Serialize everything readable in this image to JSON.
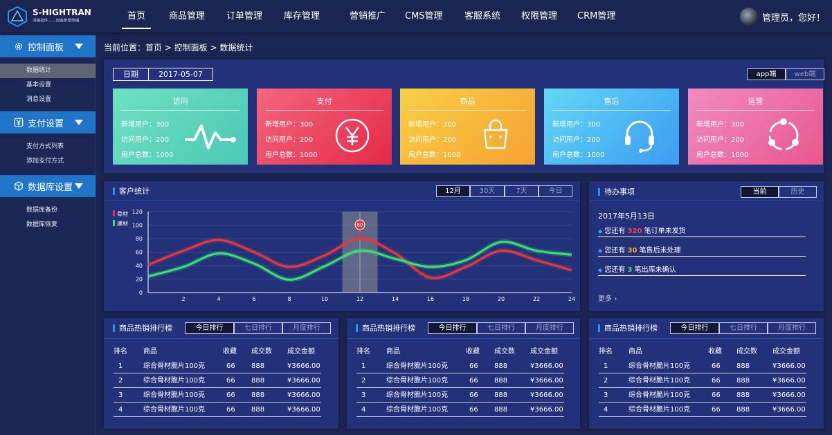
{
  "brand": {
    "name": "S-HIGHTRAN",
    "slogan": "洪锋软件——创造梦想传播"
  },
  "nav": [
    "首页",
    "商品管理",
    "订单管理",
    "库存管理",
    "营销推广",
    "CMS管理",
    "客服系统",
    "权限管理",
    "CRM管理"
  ],
  "user": {
    "greeting": "管理员，您好！"
  },
  "sidebar": {
    "groups": [
      {
        "title": "控制面板",
        "items": [
          "数据统计",
          "基本设置",
          "消息设置"
        ]
      },
      {
        "title": "支付设置",
        "items": [
          "支付方式列表",
          "添加支付方式"
        ]
      },
      {
        "title": "数据库设置",
        "items": [
          "数据库备份",
          "数据库恢复"
        ]
      }
    ]
  },
  "breadcrumb": "当前位置：首页 > 控制面板 > 数据统计",
  "date_filter": {
    "label": "日期",
    "value": "2017-05-07"
  },
  "platform_toggle": [
    "app端",
    "web端"
  ],
  "stat_labels": [
    "新增用户：",
    "访问用户：",
    "用户总数："
  ],
  "cards": [
    {
      "title": "访问",
      "values": [
        "300",
        "200",
        "1000"
      ],
      "icon": "pulse-icon",
      "colors": [
        "#6fe1c0",
        "#4cc8b6"
      ]
    },
    {
      "title": "支付",
      "values": [
        "300",
        "200",
        "1000"
      ],
      "icon": "yen-icon",
      "colors": [
        "#f5657d",
        "#e42a48"
      ]
    },
    {
      "title": "商品",
      "values": [
        "300",
        "200",
        "1000"
      ],
      "icon": "bag-icon",
      "colors": [
        "#f9cf47",
        "#f6a230"
      ]
    },
    {
      "title": "售后",
      "values": [
        "300",
        "200",
        "1000"
      ],
      "icon": "headset-icon",
      "colors": [
        "#62d7f5",
        "#3c9cf1"
      ]
    },
    {
      "title": "运营",
      "values": [
        "300",
        "200",
        "1000"
      ],
      "icon": "cycle-icon",
      "colors": [
        "#f08cc1",
        "#e8578e"
      ]
    }
  ],
  "customer_stats": {
    "title": "客户统计",
    "tabs": [
      "12月",
      "30天",
      "7天",
      "今日"
    ],
    "chart_data": {
      "type": "line",
      "x": [
        0,
        2,
        4,
        6,
        8,
        10,
        12,
        14,
        16,
        18,
        20,
        22,
        24
      ],
      "x_ticks": [
        2,
        4,
        6,
        8,
        10,
        12,
        14,
        16,
        18,
        20,
        22,
        24
      ],
      "ylim": [
        0,
        120
      ],
      "y_ticks": [
        0,
        20,
        40,
        60,
        80,
        100,
        120
      ],
      "series": [
        {
          "name": "骨材",
          "color": "#e8383d",
          "values": [
            41,
            62,
            78,
            60,
            38,
            55,
            80,
            58,
            22,
            38,
            62,
            48,
            33
          ]
        },
        {
          "name": "建材",
          "color": "#39e26e",
          "values": [
            24,
            38,
            58,
            43,
            19,
            39,
            62,
            50,
            38,
            48,
            75,
            62,
            56
          ]
        }
      ],
      "highlight": {
        "x": 12,
        "label": "80"
      },
      "grid": true,
      "legend": "top-left"
    }
  },
  "todo": {
    "title": "待办事项",
    "tabs": [
      "当前",
      "历史"
    ],
    "date": "2017年5月13日",
    "items": [
      {
        "pre": "您还有",
        "num": "320",
        "post": "笔订单未发货",
        "color": "#f04852"
      },
      {
        "pre": "您还有",
        "num": "30",
        "post": "笔售后未处理",
        "color": "#f6a623"
      },
      {
        "pre": "您还有",
        "num": "3",
        "post": "笔出库未确认",
        "color": "#39e26e"
      }
    ],
    "more": "更多"
  },
  "rankings": {
    "title": "商品热销排行榜",
    "tabs": [
      "今日排行",
      "七日排行",
      "月度排行"
    ],
    "columns": [
      "排名",
      "商品",
      "收藏",
      "成交数",
      "成交金额"
    ],
    "rows": [
      [
        "1",
        "综合骨材脆片100克",
        "66",
        "888",
        "¥3666.00"
      ],
      [
        "2",
        "综合骨材脆片100克",
        "66",
        "888",
        "¥3666.00"
      ],
      [
        "3",
        "综合骨材脆片100克",
        "66",
        "888",
        "¥3666.00"
      ],
      [
        "4",
        "综合骨材脆片100克",
        "66",
        "888",
        "¥3666.00"
      ]
    ]
  }
}
